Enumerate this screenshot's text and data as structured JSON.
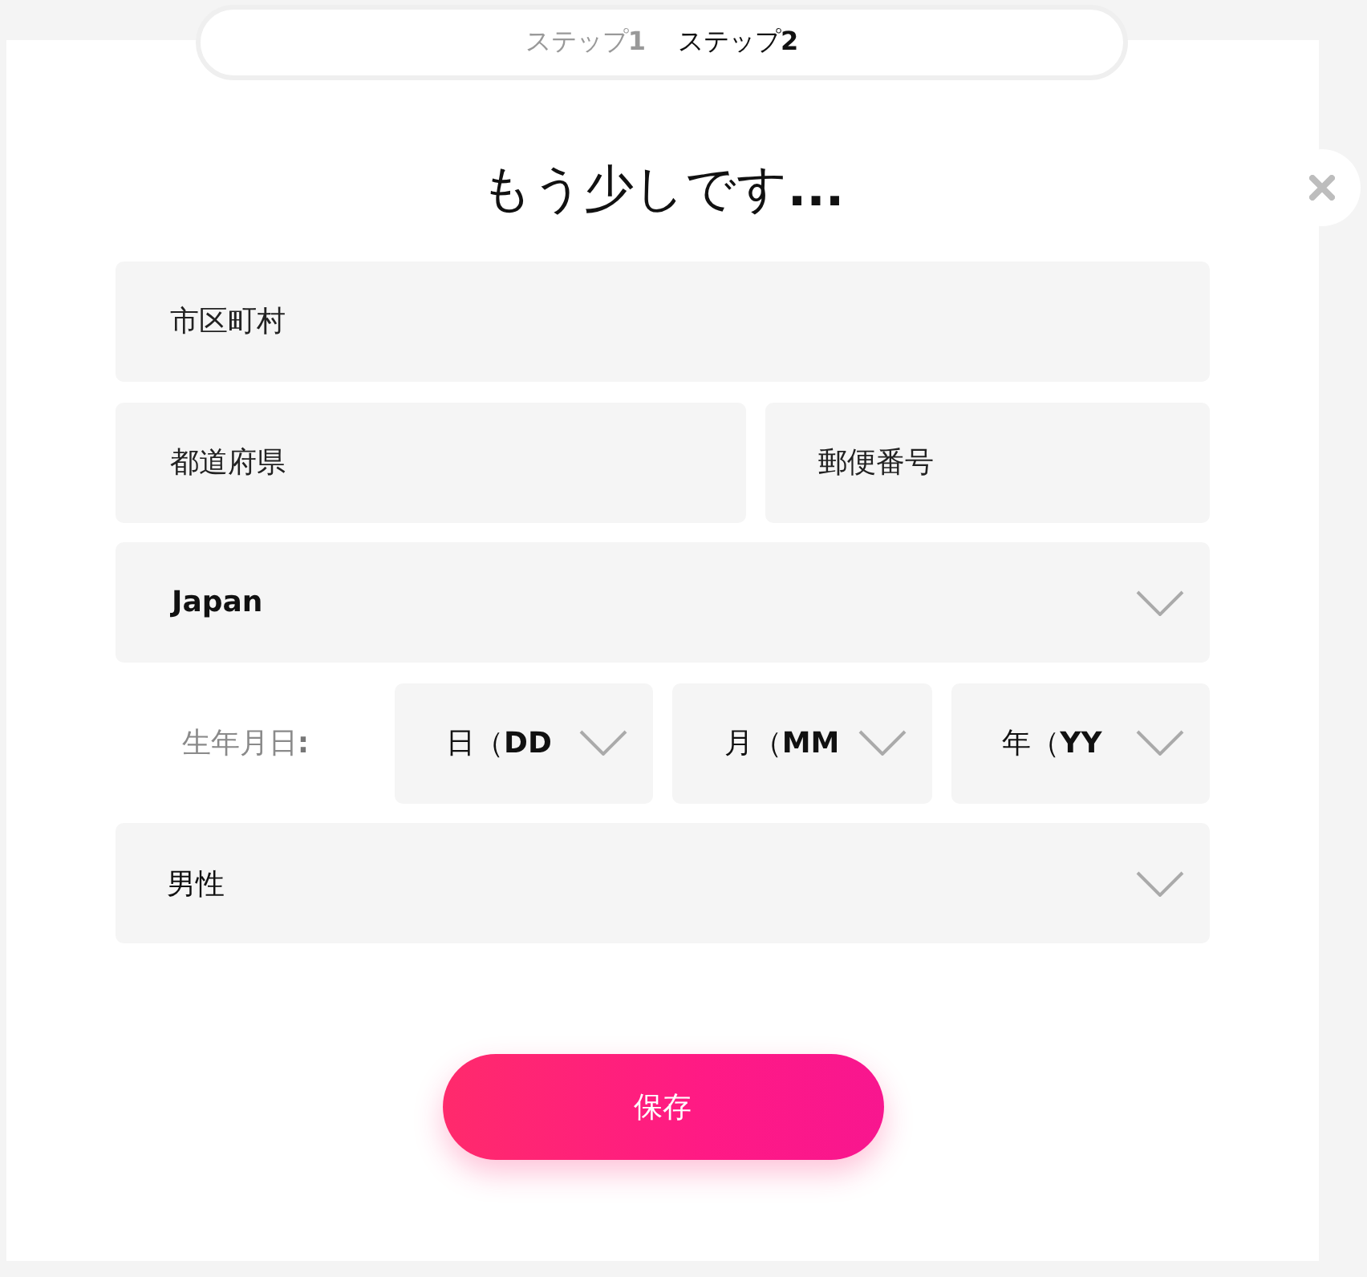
{
  "steps": [
    {
      "label": "ステップ**1**",
      "selected": false
    },
    {
      "label": "ステップ**2**",
      "selected": true
    }
  ],
  "title": "もう少しです**...**",
  "form": {
    "city": {
      "placeholder": "市区町村"
    },
    "prefecture": {
      "placeholder": "都道府県"
    },
    "postal_code": {
      "placeholder": "郵便番号"
    },
    "country": {
      "value": "Japan"
    },
    "birth_date": {
      "label": "生年月日**:**",
      "selects": [
        {
          "value": "日（**DD**"
        },
        {
          "value": "月（**MM**"
        },
        {
          "value": "年（**YY**"
        }
      ]
    },
    "gender": {
      "value": "男性"
    }
  },
  "save_button": {
    "label": "保存"
  }
}
